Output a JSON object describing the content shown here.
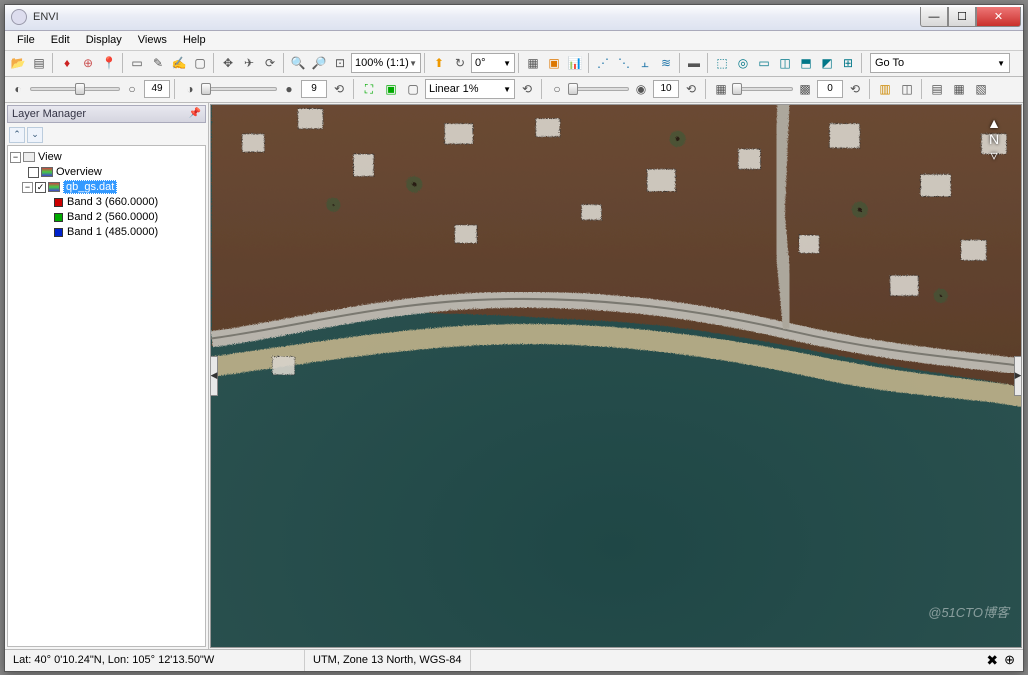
{
  "window": {
    "title": "ENVI"
  },
  "menu": [
    "File",
    "Edit",
    "Display",
    "Views",
    "Help"
  ],
  "toolbar": {
    "zoom": "100% (1:1)",
    "rotation": "0°",
    "goto": "Go To"
  },
  "toolbar2": {
    "brightness": "49",
    "sharpen": "9",
    "stretch": "Linear 1%",
    "transparency": "10",
    "blend": "0"
  },
  "layermanager": {
    "title": "Layer Manager",
    "root": "View",
    "overview": "Overview",
    "dataset": "qb_gs.dat",
    "bands": [
      {
        "label": "Band 3 (660.0000)",
        "color": "#c00"
      },
      {
        "label": "Band 2 (560.0000)",
        "color": "#0a0"
      },
      {
        "label": "Band 1 (485.0000)",
        "color": "#02c"
      }
    ]
  },
  "status": {
    "coords": "Lat: 40° 0'10.24\"N, Lon: 105° 12'13.50\"W",
    "proj": "UTM, Zone 13 North, WGS-84"
  },
  "watermark": "@51CTO博客"
}
